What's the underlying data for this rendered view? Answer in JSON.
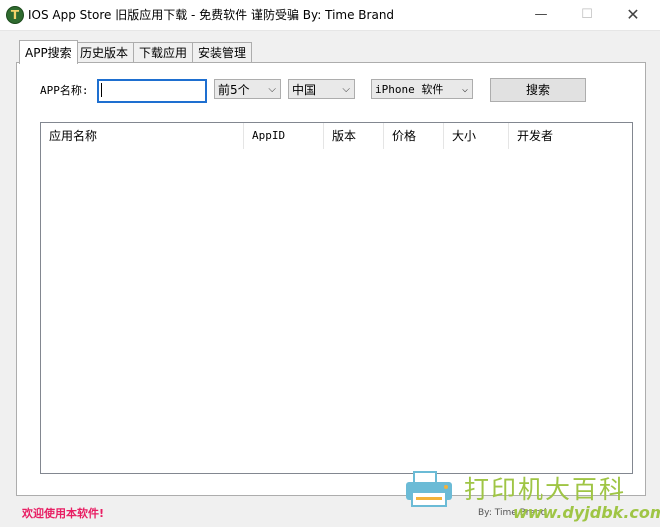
{
  "window": {
    "title": "IOS App Store 旧版应用下载 - 免费软件 谨防受骗 By: Time Brand",
    "icon_letter": "T",
    "minimize_icon": "—",
    "maximize_icon": "☐",
    "close_icon": "✕"
  },
  "tabs": [
    {
      "label": "APP搜索",
      "active": true
    },
    {
      "label": "历史版本",
      "active": false
    },
    {
      "label": "下载应用",
      "active": false
    },
    {
      "label": "安装管理",
      "active": false
    }
  ],
  "search": {
    "app_name_label": "APP名称:",
    "app_name_value": "",
    "count_select": "前5个",
    "country_select": "中国",
    "device_select": "iPhone 软件",
    "search_button": "搜索"
  },
  "table": {
    "columns": [
      "应用名称",
      "AppID",
      "版本",
      "价格",
      "大小",
      "开发者"
    ],
    "rows": []
  },
  "status": {
    "welcome": "欢迎使用本软件!",
    "right_text": "By: Time Brand"
  },
  "watermark": {
    "text": "打印机大百科",
    "url": "www.dyjdbk.com"
  },
  "colors": {
    "accent_focus": "#1e6fd0",
    "status_text": "#e81e63",
    "watermark_green": "#9fc545"
  }
}
